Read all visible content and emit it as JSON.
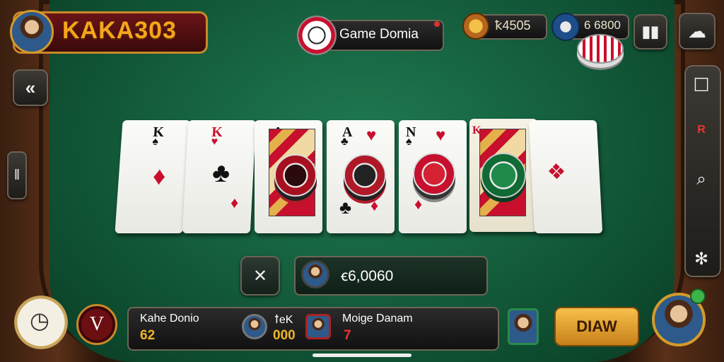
{
  "player": {
    "name": "KAKA303"
  },
  "header": {
    "game_title": "Game Domia",
    "coins": "ꝁ4505",
    "chips": "6 6800"
  },
  "pot": {
    "amount": "ꞓ6,0060"
  },
  "scoreboard": {
    "p1_name": "Kahe Donio",
    "p1_score": "62",
    "p2_name": "ꝉeK",
    "p2_score": "000",
    "p3_name": "Moige Danam",
    "p3_score": "7"
  },
  "controls": {
    "draw_label": "DIAW",
    "timer_icon": "clock-icon",
    "badge": "V"
  },
  "cards": [
    {
      "rank": "K",
      "color": "#111"
    },
    {
      "rank": "K",
      "color": "#c8102e"
    },
    {
      "rank": "A",
      "color": "#111"
    },
    {
      "rank": "A",
      "color": "#111"
    },
    {
      "rank": "N",
      "color": "#111"
    },
    {
      "rank": "K",
      "color": "#c8102e"
    },
    {
      "rank": "",
      "color": "#c8102e"
    }
  ],
  "colors": {
    "felt": "#15603e",
    "gold": "#d49a2a",
    "accent_red": "#c8102e"
  }
}
